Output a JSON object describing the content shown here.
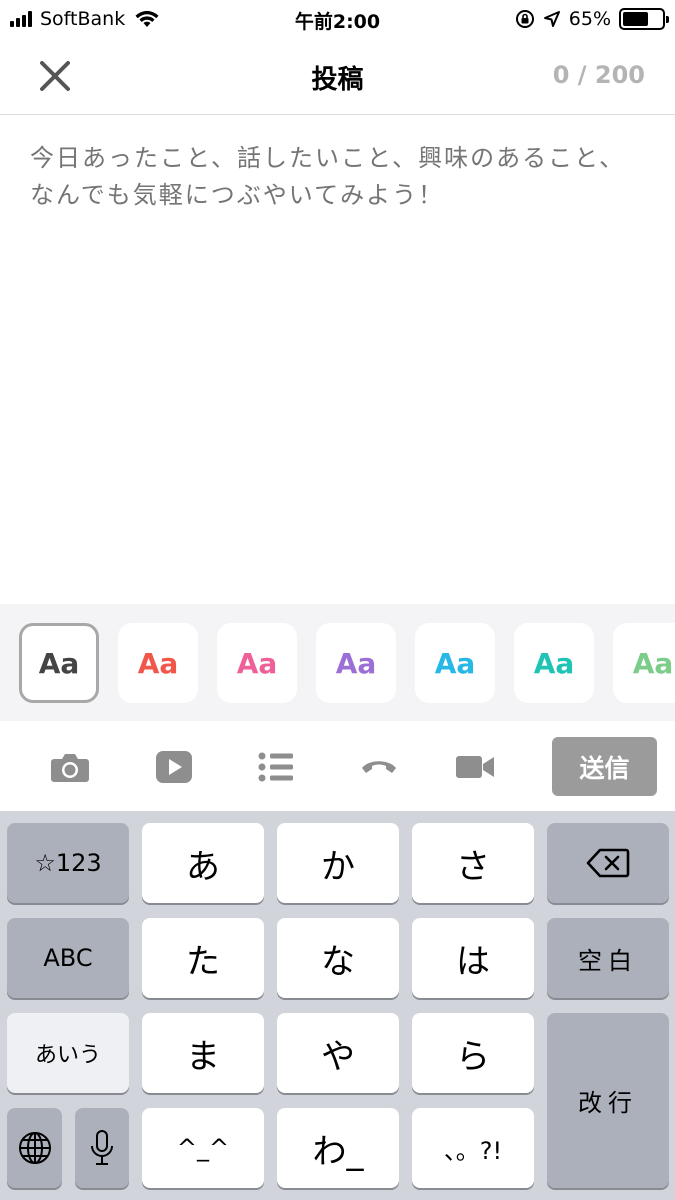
{
  "status_bar": {
    "carrier": "SoftBank",
    "time": "午前2:00",
    "battery_percent": "65%",
    "battery_level": 0.65
  },
  "nav": {
    "title": "投稿",
    "char_counter": "0 / 200"
  },
  "editor": {
    "placeholder": "今日あったこと、話したいこと、興味のあること、なんでも気軽につぶやいてみよう！",
    "value": ""
  },
  "text_colors": [
    {
      "label": "Aa",
      "color": "#444444",
      "selected": true
    },
    {
      "label": "Aa",
      "color": "#f0564a",
      "selected": false
    },
    {
      "label": "Aa",
      "color": "#ef5f98",
      "selected": false
    },
    {
      "label": "Aa",
      "color": "#9b6fd6",
      "selected": false
    },
    {
      "label": "Aa",
      "color": "#27b8e8",
      "selected": false
    },
    {
      "label": "Aa",
      "color": "#1fc4b4",
      "selected": false
    },
    {
      "label": "Aa",
      "color": "#7ccc8a",
      "selected": false
    }
  ],
  "toolbar": {
    "icons": [
      "camera-icon",
      "play-icon",
      "list-icon",
      "phone-icon",
      "video-camera-icon"
    ],
    "send_label": "送信"
  },
  "keyboard": {
    "numbers_key": "☆123",
    "abc_key": "ABC",
    "kana_key": "あいう",
    "space_key": "空白",
    "return_key": "改行",
    "row1": [
      "あ",
      "か",
      "さ"
    ],
    "row2": [
      "た",
      "な",
      "は"
    ],
    "row3": [
      "ま",
      "や",
      "ら"
    ],
    "row4": [
      "^_^",
      "わ_",
      "、。?!"
    ],
    "delete_icon": "backspace-icon",
    "globe_icon": "globe-icon",
    "mic_icon": "microphone-icon"
  },
  "colors": {
    "send_button": "#9b9b9b",
    "keyboard_bg": "#d1d4db",
    "placeholder": "#c8c8c8"
  }
}
